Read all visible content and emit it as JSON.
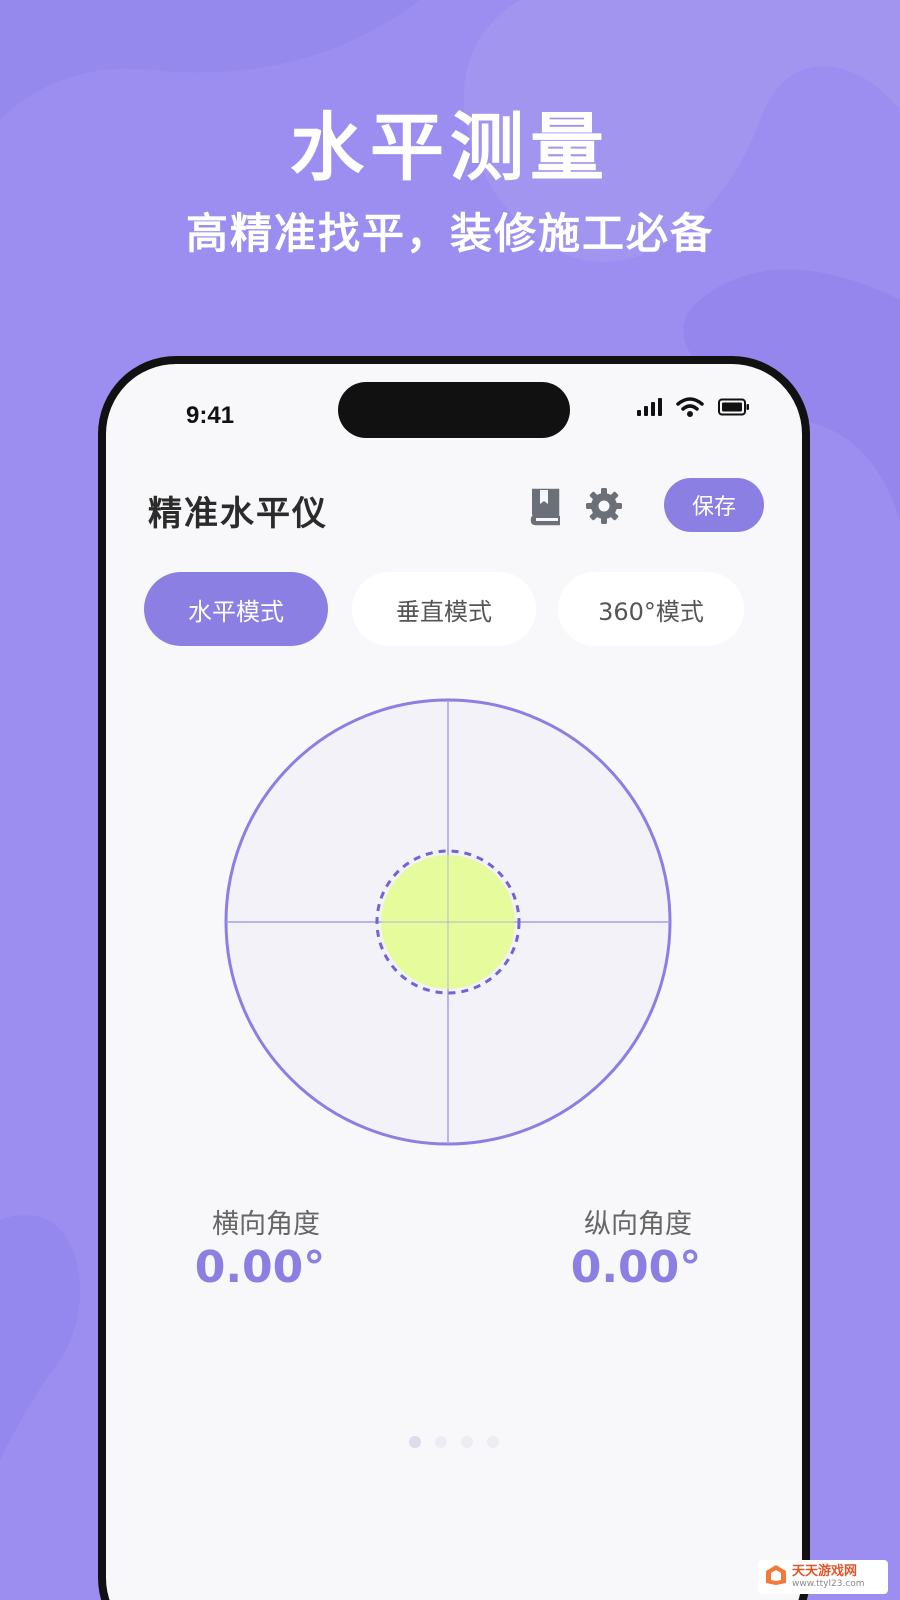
{
  "promo": {
    "title": "水平测量",
    "subtitle": "高精准找平，装修施工必备"
  },
  "status_bar": {
    "time": "9:41",
    "icons": [
      "cellular-signal-icon",
      "wifi-icon",
      "battery-icon"
    ]
  },
  "header": {
    "title": "精准水平仪",
    "book_icon": "book-icon",
    "settings_icon": "gear-icon",
    "save_label": "保存"
  },
  "modes": [
    {
      "label": "水平模式",
      "active": true
    },
    {
      "label": "垂直模式",
      "active": false
    },
    {
      "label": "360°模式",
      "active": false
    }
  ],
  "readings": {
    "horizontal_label": "横向角度",
    "horizontal_value": "0.00°",
    "vertical_label": "纵向角度",
    "vertical_value": "0.00°"
  },
  "pagination": {
    "count": 4,
    "active_index": 0
  },
  "colors": {
    "accent": "#8b7fe3",
    "background": "#9b8ef0",
    "bubble": "#e6fb9c"
  },
  "watermark": {
    "text": "天天游戏网",
    "url": "www.ttyl23.com"
  }
}
